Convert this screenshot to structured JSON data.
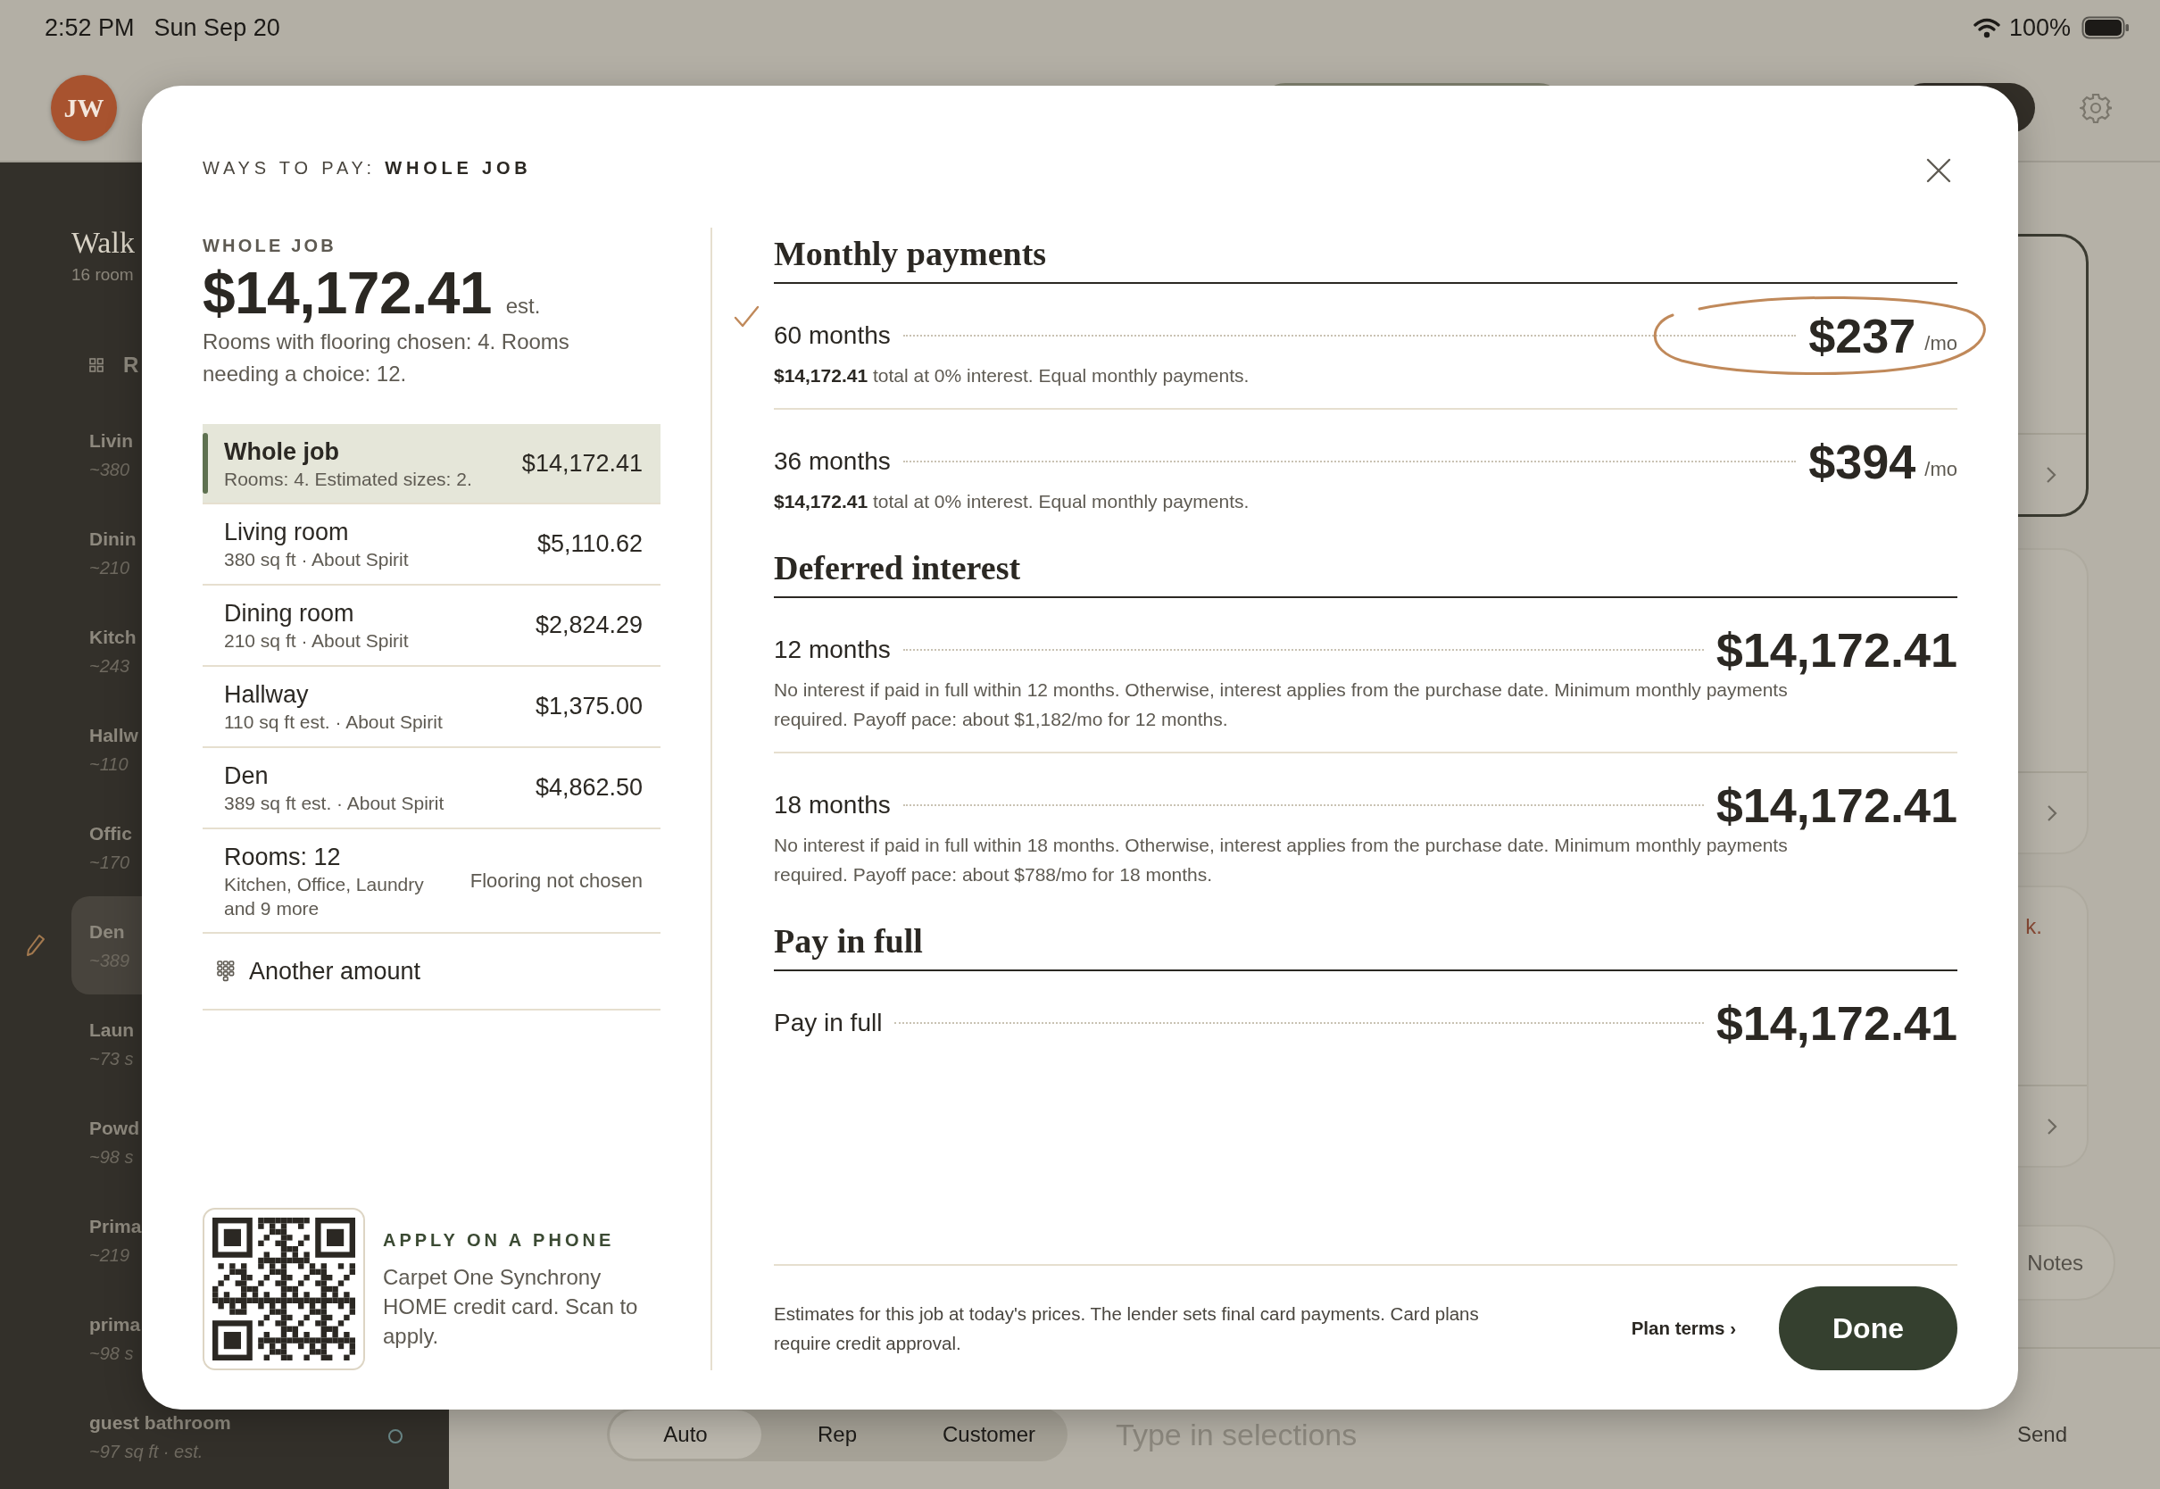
{
  "status_bar": {
    "time": "2:52 PM",
    "date": "Sun Sep 20",
    "battery": "100%"
  },
  "header": {
    "avatar": "JW"
  },
  "sidebar": {
    "title": "Walk",
    "subtitle": "16 room",
    "section": "R",
    "rooms": [
      {
        "name": "Livin",
        "size": "~380",
        "selected": false
      },
      {
        "name": "Dinin",
        "size": "~210",
        "selected": false
      },
      {
        "name": "Kitch",
        "size": "~243",
        "selected": false
      },
      {
        "name": "Hallw",
        "size": "~110",
        "selected": false
      },
      {
        "name": "Offic",
        "size": "~170",
        "selected": false
      },
      {
        "name": "Den",
        "size": "~389",
        "selected": true
      },
      {
        "name": "Laun",
        "size": "~73 s",
        "selected": false
      },
      {
        "name": "Powd",
        "size": "~98 s",
        "selected": false
      },
      {
        "name": "Prima",
        "size": "~219",
        "selected": false
      },
      {
        "name": "prima",
        "size": "~98 s",
        "selected": false
      },
      {
        "name": "guest bathroom",
        "size": "~97 sq ft · est.",
        "selected": false,
        "indicator": true
      }
    ]
  },
  "cards": [
    {
      "selected": true
    },
    {
      "selected": false
    },
    {
      "selected": false,
      "text": "k."
    }
  ],
  "notes_button": "Notes",
  "composer": {
    "modes": [
      {
        "label": "Auto",
        "selected": true
      },
      {
        "label": "Rep",
        "selected": false
      },
      {
        "label": "Customer",
        "selected": false
      }
    ],
    "placeholder": "Type in selections",
    "send": "Send"
  },
  "dialog": {
    "title": "WAYS TO PAY: **WHOLE JOB**",
    "scope_label": "WHOLE JOB",
    "total": "$14,172.41",
    "total_suffix": "est.",
    "summary": "Rooms with flooring chosen: 4. Rooms needing a choice: 12.",
    "items": [
      {
        "kind": "priced",
        "title": "Whole job",
        "detail": "Rooms: 4. Estimated sizes: 2.",
        "amount": "$14,172.41",
        "selected": true
      },
      {
        "kind": "priced",
        "title": "Living room",
        "detail": "380 sq ft · About Spirit",
        "amount": "$5,110.62",
        "selected": false
      },
      {
        "kind": "priced",
        "title": "Dining room",
        "detail": "210 sq ft · About Spirit",
        "amount": "$2,824.29",
        "selected": false
      },
      {
        "kind": "priced",
        "title": "Hallway",
        "detail": "110 sq ft est. · About Spirit",
        "amount": "$1,375.00",
        "selected": false
      },
      {
        "kind": "priced",
        "title": "Den",
        "detail": "389 sq ft est. · About Spirit",
        "amount": "$4,862.50",
        "selected": false
      },
      {
        "kind": "unpriced",
        "title": "Rooms: 12",
        "detail": "Kitchen, Office, Laundry and 9 more",
        "amount": "Flooring not chosen",
        "selected": false
      }
    ],
    "another_amount": "Another amount",
    "apply": {
      "heading": "APPLY ON A PHONE",
      "text": "Carpet One Synchrony HOME credit card. Scan to apply."
    },
    "sections": [
      {
        "title": "Monthly payments",
        "plans": [
          {
            "term": "60 months",
            "amount": "$237",
            "unit": "/mo",
            "note": "**$14,172.41** total at 0% interest. Equal monthly payments.",
            "selected": true
          },
          {
            "term": "36 months",
            "amount": "$394",
            "unit": "/mo",
            "note": "**$14,172.41** total at 0% interest. Equal monthly payments.",
            "selected": false
          }
        ]
      },
      {
        "title": "Deferred interest",
        "plans": [
          {
            "term": "12 months",
            "amount": "$14,172.41",
            "note": "No interest if paid in full within 12 months. Otherwise, interest applies from the purchase date. Minimum monthly payments required. Payoff pace: about $1,182/mo for 12 months.",
            "selected": false
          },
          {
            "term": "18 months",
            "amount": "$14,172.41",
            "note": "No interest if paid in full within 18 months. Otherwise, interest applies from the purchase date. Minimum monthly payments required. Payoff pace: about $788/mo for 18 months.",
            "selected": false
          }
        ]
      },
      {
        "title": "Pay in full",
        "plans": [
          {
            "term": "Pay in full",
            "amount": "$14,172.41",
            "selected": false
          }
        ]
      }
    ],
    "footnote": "Estimates for this job at today's prices. The lender sets final card payments. Card plans require credit approval.",
    "plan_terms": "Plan terms ›",
    "done": "Done"
  }
}
